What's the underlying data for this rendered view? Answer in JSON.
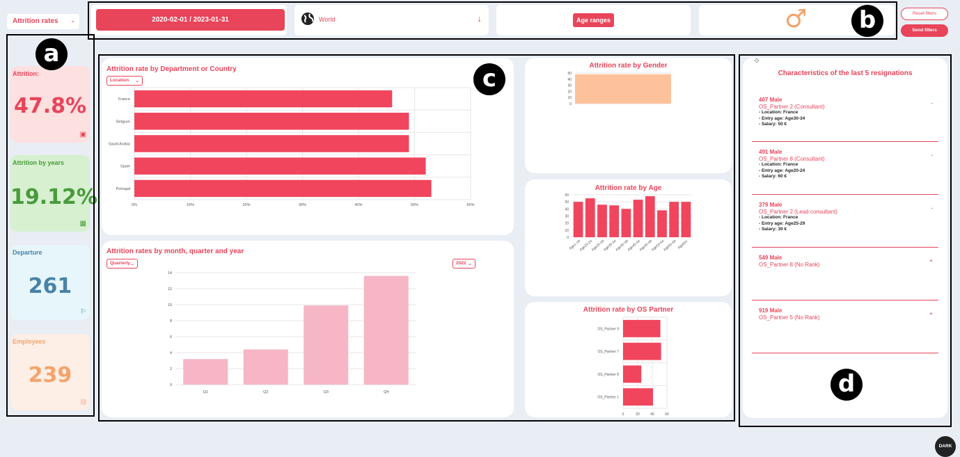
{
  "topbar": {
    "metric_select": "Attrition rates",
    "date_range": "2020-02-01 / 2023-01-31",
    "location": "World",
    "age_ranges": "Age ranges",
    "gender_symbol": "♂",
    "reset": "Reset filters",
    "send": "Send filters"
  },
  "kpis": [
    {
      "label": "Attrition:",
      "value": "47.8%"
    },
    {
      "label": "Attrition by years",
      "value": "19.12%"
    },
    {
      "label": "Departure",
      "value": "261"
    },
    {
      "label": "Employees",
      "value": "239"
    }
  ],
  "annotations": {
    "a": "a",
    "b": "b",
    "c": "c",
    "d": "d"
  },
  "dept": {
    "title": "Attrition rate by Department or Country",
    "select": "Location"
  },
  "monthly": {
    "title": "Attrition rates by month, quarter and year",
    "period_select": "Quarterly",
    "year_select": "2022"
  },
  "gender_chart": {
    "title": "Attrition rate by Gender"
  },
  "age_chart": {
    "title": "Attrition rate by Age"
  },
  "partner_chart": {
    "title": "Attrition rate by OS Partner"
  },
  "resignations": {
    "title": "Characteristics of the last 5 resignations",
    "items": [
      {
        "title": "407 Male",
        "subtitle": "OS_Partner 2 (Consultant)",
        "toggle": "-",
        "details": [
          "- Location: France",
          "- Entry age: Age30-34",
          "- Salary: 50 €"
        ]
      },
      {
        "title": "491 Male",
        "subtitle": "OS_Partner 8 (Consultant)",
        "toggle": "-",
        "details": [
          "- Location: France",
          "- Entry age: Age20-24",
          "- Salary: 60 €"
        ]
      },
      {
        "title": "379 Male",
        "subtitle": "OS_Partner 2 (Lead consultant)",
        "toggle": "-",
        "details": [
          "- Location: France",
          "- Entry age: Age25-29",
          "- Salary: 30 €"
        ]
      },
      {
        "title": "549 Male",
        "subtitle": "OS_Partner 8 (No Rank)",
        "toggle": "+",
        "details": []
      },
      {
        "title": "919 Male",
        "subtitle": "OS_Partner 5 (No Rank)",
        "toggle": "+",
        "details": []
      }
    ]
  },
  "dark_button": "DARK",
  "colors": {
    "accent": "#e8445a",
    "attrition_bg": "#fde0e0",
    "years_bg": "#d6f0d0",
    "departure_bg": "#e6f6fb",
    "employees_bg": "#fdeee6"
  },
  "chart_data": [
    {
      "type": "bar",
      "orientation": "horizontal",
      "title": "Attrition rate by Department or Country",
      "categories": [
        "France",
        "Belgium",
        "Saudi Arabia",
        "Spain",
        "Portugal"
      ],
      "values": [
        46,
        49,
        49,
        52,
        53
      ],
      "x_ticks": [
        "0%",
        "10%",
        "20%",
        "30%",
        "40%",
        "50%",
        "60%"
      ],
      "xlim": [
        0,
        60
      ]
    },
    {
      "type": "bar",
      "title": "Attrition rates by month, quarter and year",
      "categories": [
        "Q1",
        "Q2",
        "Q3",
        "Q4"
      ],
      "values": [
        3.2,
        4.4,
        9.9,
        13.6
      ],
      "y_ticks": [
        "0",
        "2",
        "4",
        "6",
        "8",
        "10",
        "12",
        "14"
      ],
      "ylim": [
        0,
        14
      ]
    },
    {
      "type": "bar",
      "title": "Attrition rate by Gender",
      "categories": [
        ""
      ],
      "values": [
        48
      ],
      "y_ticks": [
        "0",
        "10",
        "20",
        "30",
        "40",
        "50"
      ],
      "ylim": [
        0,
        50
      ]
    },
    {
      "type": "bar",
      "title": "Attrition rate by Age",
      "categories": [
        "Age1-19",
        "Age20-24",
        "Age25-29",
        "Age30-34",
        "Age35-39",
        "Age40-44",
        "Age45-49",
        "Age50-54",
        "Age55-59",
        "Age60+"
      ],
      "values": [
        50,
        55,
        46,
        45,
        40,
        53,
        58,
        38,
        50,
        50
      ],
      "y_ticks": [
        "0",
        "10",
        "20",
        "30",
        "40",
        "50",
        "60"
      ],
      "ylim": [
        0,
        60
      ]
    },
    {
      "type": "bar",
      "orientation": "horizontal",
      "title": "Attrition rate by OS Partner",
      "categories": [
        "OS_Partner 9",
        "OS_Partner 7",
        "OS_Partner 8",
        "OS_Partner 1"
      ],
      "values": [
        51,
        52,
        25,
        41
      ],
      "x_ticks": [
        "0",
        "20",
        "40",
        "60"
      ],
      "xlim": [
        0,
        60
      ]
    }
  ]
}
